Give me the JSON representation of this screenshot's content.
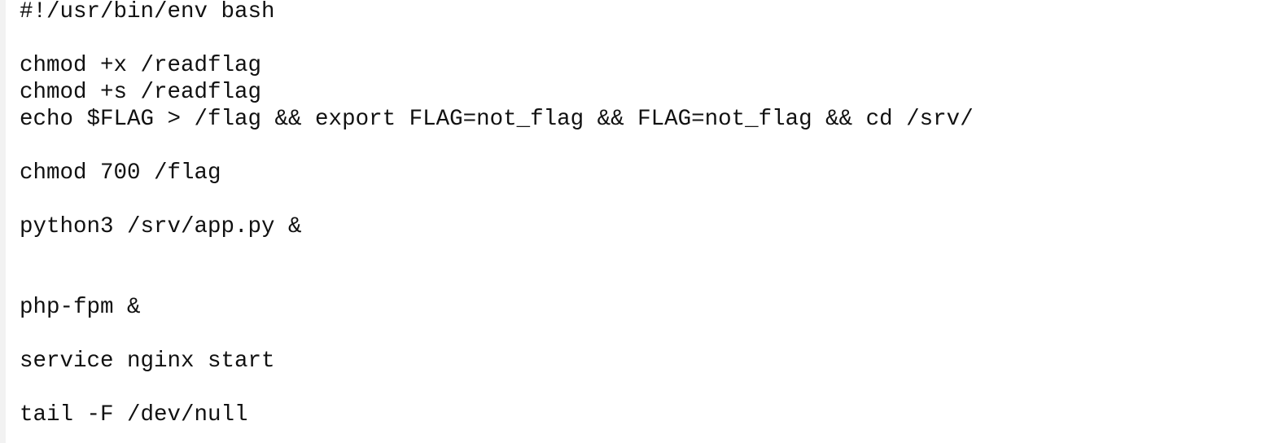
{
  "lines": [
    "#!/usr/bin/env bash",
    "",
    "chmod +x /readflag",
    "chmod +s /readflag",
    "echo $FLAG > /flag && export FLAG=not_flag && FLAG=not_flag && cd /srv/",
    "",
    "chmod 700 /flag",
    "",
    "python3 /srv/app.py &",
    "",
    "",
    "php-fpm &",
    "",
    "service nginx start",
    "",
    "tail -F /dev/null"
  ]
}
